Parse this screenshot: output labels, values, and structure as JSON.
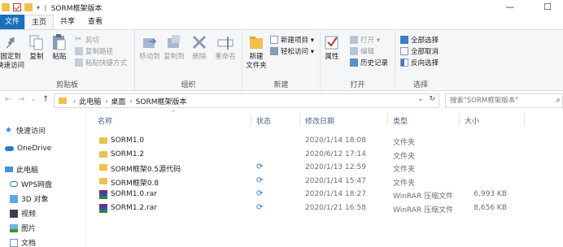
{
  "window": {
    "title": "SORM框架版本",
    "qa_separator": "|",
    "qa_dropdown": "▾",
    "minimize": "—",
    "maximize": "☐"
  },
  "tabs": [
    "文件",
    "主页",
    "共享",
    "查看"
  ],
  "ribbon": {
    "clipboard": {
      "pin": "固定到",
      "pin2": "快速访问",
      "copy": "复制",
      "paste": "粘贴",
      "cut": "剪切",
      "copy_path": "复制路径",
      "paste_shortcut": "粘贴快捷方式",
      "label": "剪贴板"
    },
    "organize": {
      "move_to": "移动到",
      "copy_to": "复制到",
      "delete": "删除",
      "rename": "重命名",
      "label": "组织"
    },
    "new": {
      "new_folder": "新建",
      "new_folder2": "文件夹",
      "new_item": "新建项目 ▾",
      "easy_access": "轻松访问 ▾",
      "label": "新建"
    },
    "open": {
      "properties": "属性",
      "open": "打开 ▾",
      "edit": "编辑",
      "history": "历史记录",
      "label": "打开"
    },
    "select": {
      "select_all": "全部选择",
      "select_none": "全部取消",
      "invert": "反向选择",
      "label": "选择"
    }
  },
  "address": {
    "back": "←",
    "forward": "→",
    "recent": "⌄",
    "up": "↑",
    "crumbs": [
      "此电脑",
      "桌面",
      "SORM框架版本"
    ],
    "crumb_sep": "›",
    "dropdown": "⌄",
    "refresh": "↻",
    "search_placeholder": "搜索\"SORM框架版本\"",
    "search_icon": "⌕"
  },
  "nav_pane": {
    "items": [
      "快速访问",
      "OneDrive",
      "此电脑",
      "WPS网盘",
      "3D 对象",
      "视频",
      "图片",
      "文档"
    ]
  },
  "file_list": {
    "sort_caret": "^",
    "sync_icon": "⟳",
    "columns": [
      "名称",
      "状态",
      "修改日期",
      "类型",
      "大小"
    ],
    "rows": [
      {
        "name": "SORM1.0",
        "date": "2020/1/14 18:08",
        "type": "文件夹",
        "size": "",
        "kind": "folder",
        "sync": false
      },
      {
        "name": "SORM1.2",
        "date": "2020/6/12 17:14",
        "type": "文件夹",
        "size": "",
        "kind": "folder",
        "sync": false
      },
      {
        "name": "SORM框架0.5源代码",
        "date": "2020/1/13 12:59",
        "type": "文件夹",
        "size": "",
        "kind": "folder",
        "sync": true
      },
      {
        "name": "SORM框架0.8",
        "date": "2020/1/14 15:47",
        "type": "文件夹",
        "size": "",
        "kind": "folder",
        "sync": true
      },
      {
        "name": "SORM1.0.rar",
        "date": "2020/1/14 18:27",
        "type": "WinRAR 压缩文件",
        "size": "6,993 KB",
        "kind": "rar",
        "sync": true
      },
      {
        "name": "SORM1.2.rar",
        "date": "2020/1/21 16:58",
        "type": "WinRAR 压缩文件",
        "size": "8,656 KB",
        "kind": "rar",
        "sync": true
      }
    ]
  },
  "colors": {
    "file_tab": "#1a6fbf",
    "folder": "#f0c04f",
    "header_text": "#4d6082",
    "sync": "#2a78c8"
  }
}
